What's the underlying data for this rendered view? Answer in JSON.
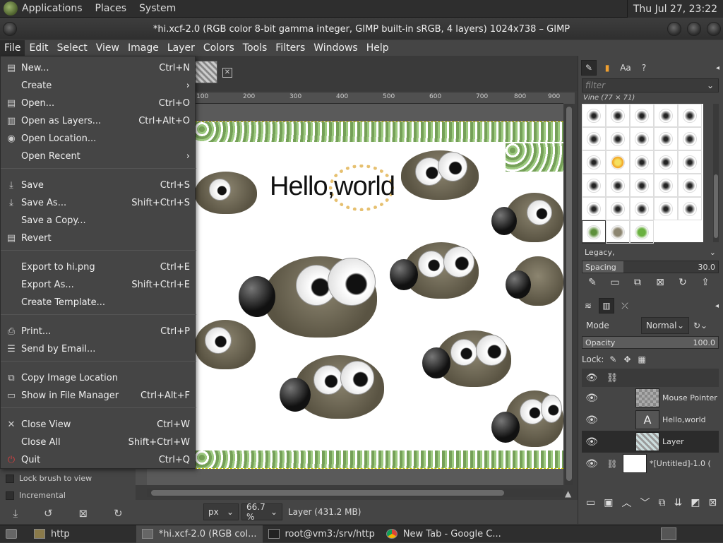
{
  "system_bar": {
    "menus": [
      "Applications",
      "Places",
      "System"
    ],
    "clock": "Thu Jul 27, 23:22"
  },
  "window": {
    "title": "*hi.xcf-2.0 (RGB color 8-bit gamma integer, GIMP built-in sRGB, 4 layers) 1024x738 – GIMP"
  },
  "menubar": [
    "File",
    "Edit",
    "Select",
    "View",
    "Image",
    "Layer",
    "Colors",
    "Tools",
    "Filters",
    "Windows",
    "Help"
  ],
  "file_menu": {
    "items": [
      {
        "label": "New...",
        "accel": "Ctrl+N",
        "icon": "new-image-icon"
      },
      {
        "label": "Create",
        "accel": "",
        "icon": "",
        "submenu": true
      },
      {
        "label": "Open...",
        "accel": "Ctrl+O",
        "icon": "open-icon"
      },
      {
        "label": "Open as Layers...",
        "accel": "Ctrl+Alt+O",
        "icon": "open-as-layers-icon"
      },
      {
        "label": "Open Location...",
        "accel": "",
        "icon": "globe-icon"
      },
      {
        "label": "Open Recent",
        "accel": "",
        "icon": "",
        "submenu": true
      },
      {
        "label": "Save",
        "accel": "Ctrl+S",
        "icon": "save-icon"
      },
      {
        "label": "Save As...",
        "accel": "Shift+Ctrl+S",
        "icon": "save-as-icon"
      },
      {
        "label": "Save a Copy...",
        "accel": "",
        "icon": ""
      },
      {
        "label": "Revert",
        "accel": "",
        "icon": "revert-icon"
      },
      {
        "label": "Export to hi.png",
        "accel": "Ctrl+E",
        "icon": ""
      },
      {
        "label": "Export As...",
        "accel": "Shift+Ctrl+E",
        "icon": ""
      },
      {
        "label": "Create Template...",
        "accel": "",
        "icon": ""
      },
      {
        "label": "Print...",
        "accel": "Ctrl+P",
        "icon": "print-icon"
      },
      {
        "label": "Send by Email...",
        "accel": "",
        "icon": "email-icon"
      },
      {
        "label": "Copy Image Location",
        "accel": "",
        "icon": "copy-icon"
      },
      {
        "label": "Show in File Manager",
        "accel": "Ctrl+Alt+F",
        "icon": "folder-icon"
      },
      {
        "label": "Close View",
        "accel": "Ctrl+W",
        "icon": "close-icon"
      },
      {
        "label": "Close All",
        "accel": "Shift+Ctrl+W",
        "icon": ""
      },
      {
        "label": "Quit",
        "accel": "Ctrl+Q",
        "icon": "quit-icon"
      }
    ]
  },
  "tool_options": {
    "lock_brush_to_view": "Lock brush to view",
    "incremental": "Incremental"
  },
  "ruler": {
    "ticks": [
      "100",
      "200",
      "300",
      "400",
      "500",
      "600",
      "700",
      "800",
      "900"
    ]
  },
  "canvas": {
    "text_layer": "Hello,world"
  },
  "status": {
    "unit": "px",
    "zoom": "66.7 %",
    "layer_info": "Layer (431.2 MB)"
  },
  "brushes": {
    "filter_placeholder": "filter",
    "selected_brush": "Vine (77 × 71)",
    "preset": "Legacy,",
    "spacing_label": "Spacing",
    "spacing_value": "30.0",
    "spacing_fraction": 0.3
  },
  "layers_panel": {
    "mode_label": "Mode",
    "mode_value": "Normal",
    "opacity_label": "Opacity",
    "opacity_value": "100.0",
    "opacity_fraction": 1.0,
    "lock_label": "Lock:",
    "layers": [
      {
        "name": "Mouse Pointer",
        "visible": true,
        "selected": false
      },
      {
        "name": "Hello,world",
        "visible": true,
        "selected": false
      },
      {
        "name": "Layer",
        "visible": true,
        "selected": true
      },
      {
        "name": "*[Untitled]-1.0 (",
        "visible": true,
        "selected": false
      }
    ]
  },
  "taskbar": {
    "tasks": [
      {
        "label": "http",
        "active": false
      },
      {
        "label": "*hi.xcf-2.0 (RGB col...",
        "active": true
      },
      {
        "label": "root@vm3:/srv/http",
        "active": false
      },
      {
        "label": "New Tab - Google C...",
        "active": false
      }
    ]
  }
}
